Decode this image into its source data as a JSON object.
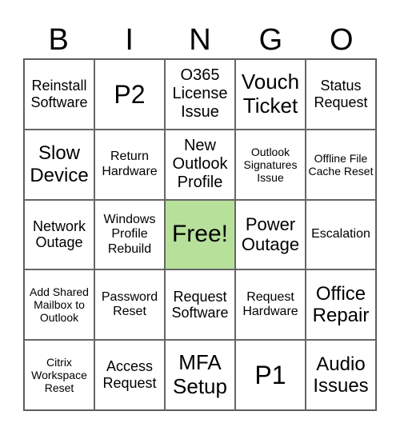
{
  "header": [
    "B",
    "I",
    "N",
    "G",
    "O"
  ],
  "cells": [
    [
      "Reinstall Software",
      "P2",
      "O365 License Issue",
      "Vouch Ticket",
      "Status Request"
    ],
    [
      "Slow Device",
      "Return Hardware",
      "New Outlook Profile",
      "Outlook Signatures Issue",
      "Offline File Cache Reset"
    ],
    [
      "Network Outage",
      "Windows Profile Rebuild",
      "Free!",
      "Power Outage",
      "Escalation"
    ],
    [
      "Add Shared Mailbox to Outlook",
      "Password Reset",
      "Request Software",
      "Request Hardware",
      "Office Repair"
    ],
    [
      "Citrix Workspace Reset",
      "Access Request",
      "MFA Setup",
      "P1",
      "Audio Issues"
    ]
  ],
  "free_color": "#b7e09b"
}
